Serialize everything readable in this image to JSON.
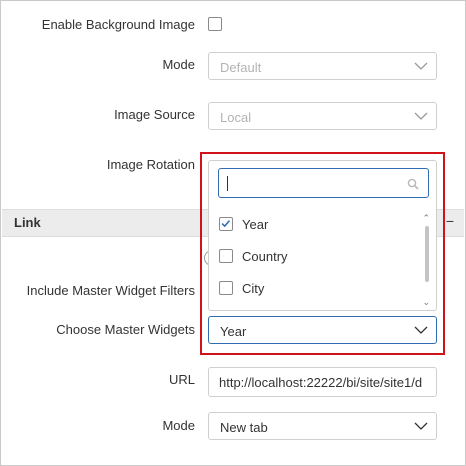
{
  "background": {
    "enable_label": "Enable Background Image",
    "mode_label": "Mode",
    "mode_value": "Default",
    "source_label": "Image Source",
    "source_value": "Local",
    "rotation_label": "Image Rotation"
  },
  "link": {
    "section_title": "Link",
    "collapse_symbol": "−",
    "include_filters_label": "Include Master Widget Filters",
    "choose_widgets_label": "Choose Master Widgets",
    "choose_widgets_value": "Year",
    "url_label": "URL",
    "url_value": "http://localhost:22222/bi/site/site1/d",
    "mode_label": "Mode",
    "mode_value": "New tab"
  },
  "popup": {
    "search_value": "",
    "items": [
      {
        "label": "Year",
        "checked": true
      },
      {
        "label": "Country",
        "checked": false
      },
      {
        "label": "City",
        "checked": false
      }
    ],
    "scroll_up": "⌃",
    "scroll_down": "⌄"
  },
  "colors": {
    "accent": "#2f6cb3",
    "highlight": "#d0121b",
    "section_bg": "#ececec"
  }
}
